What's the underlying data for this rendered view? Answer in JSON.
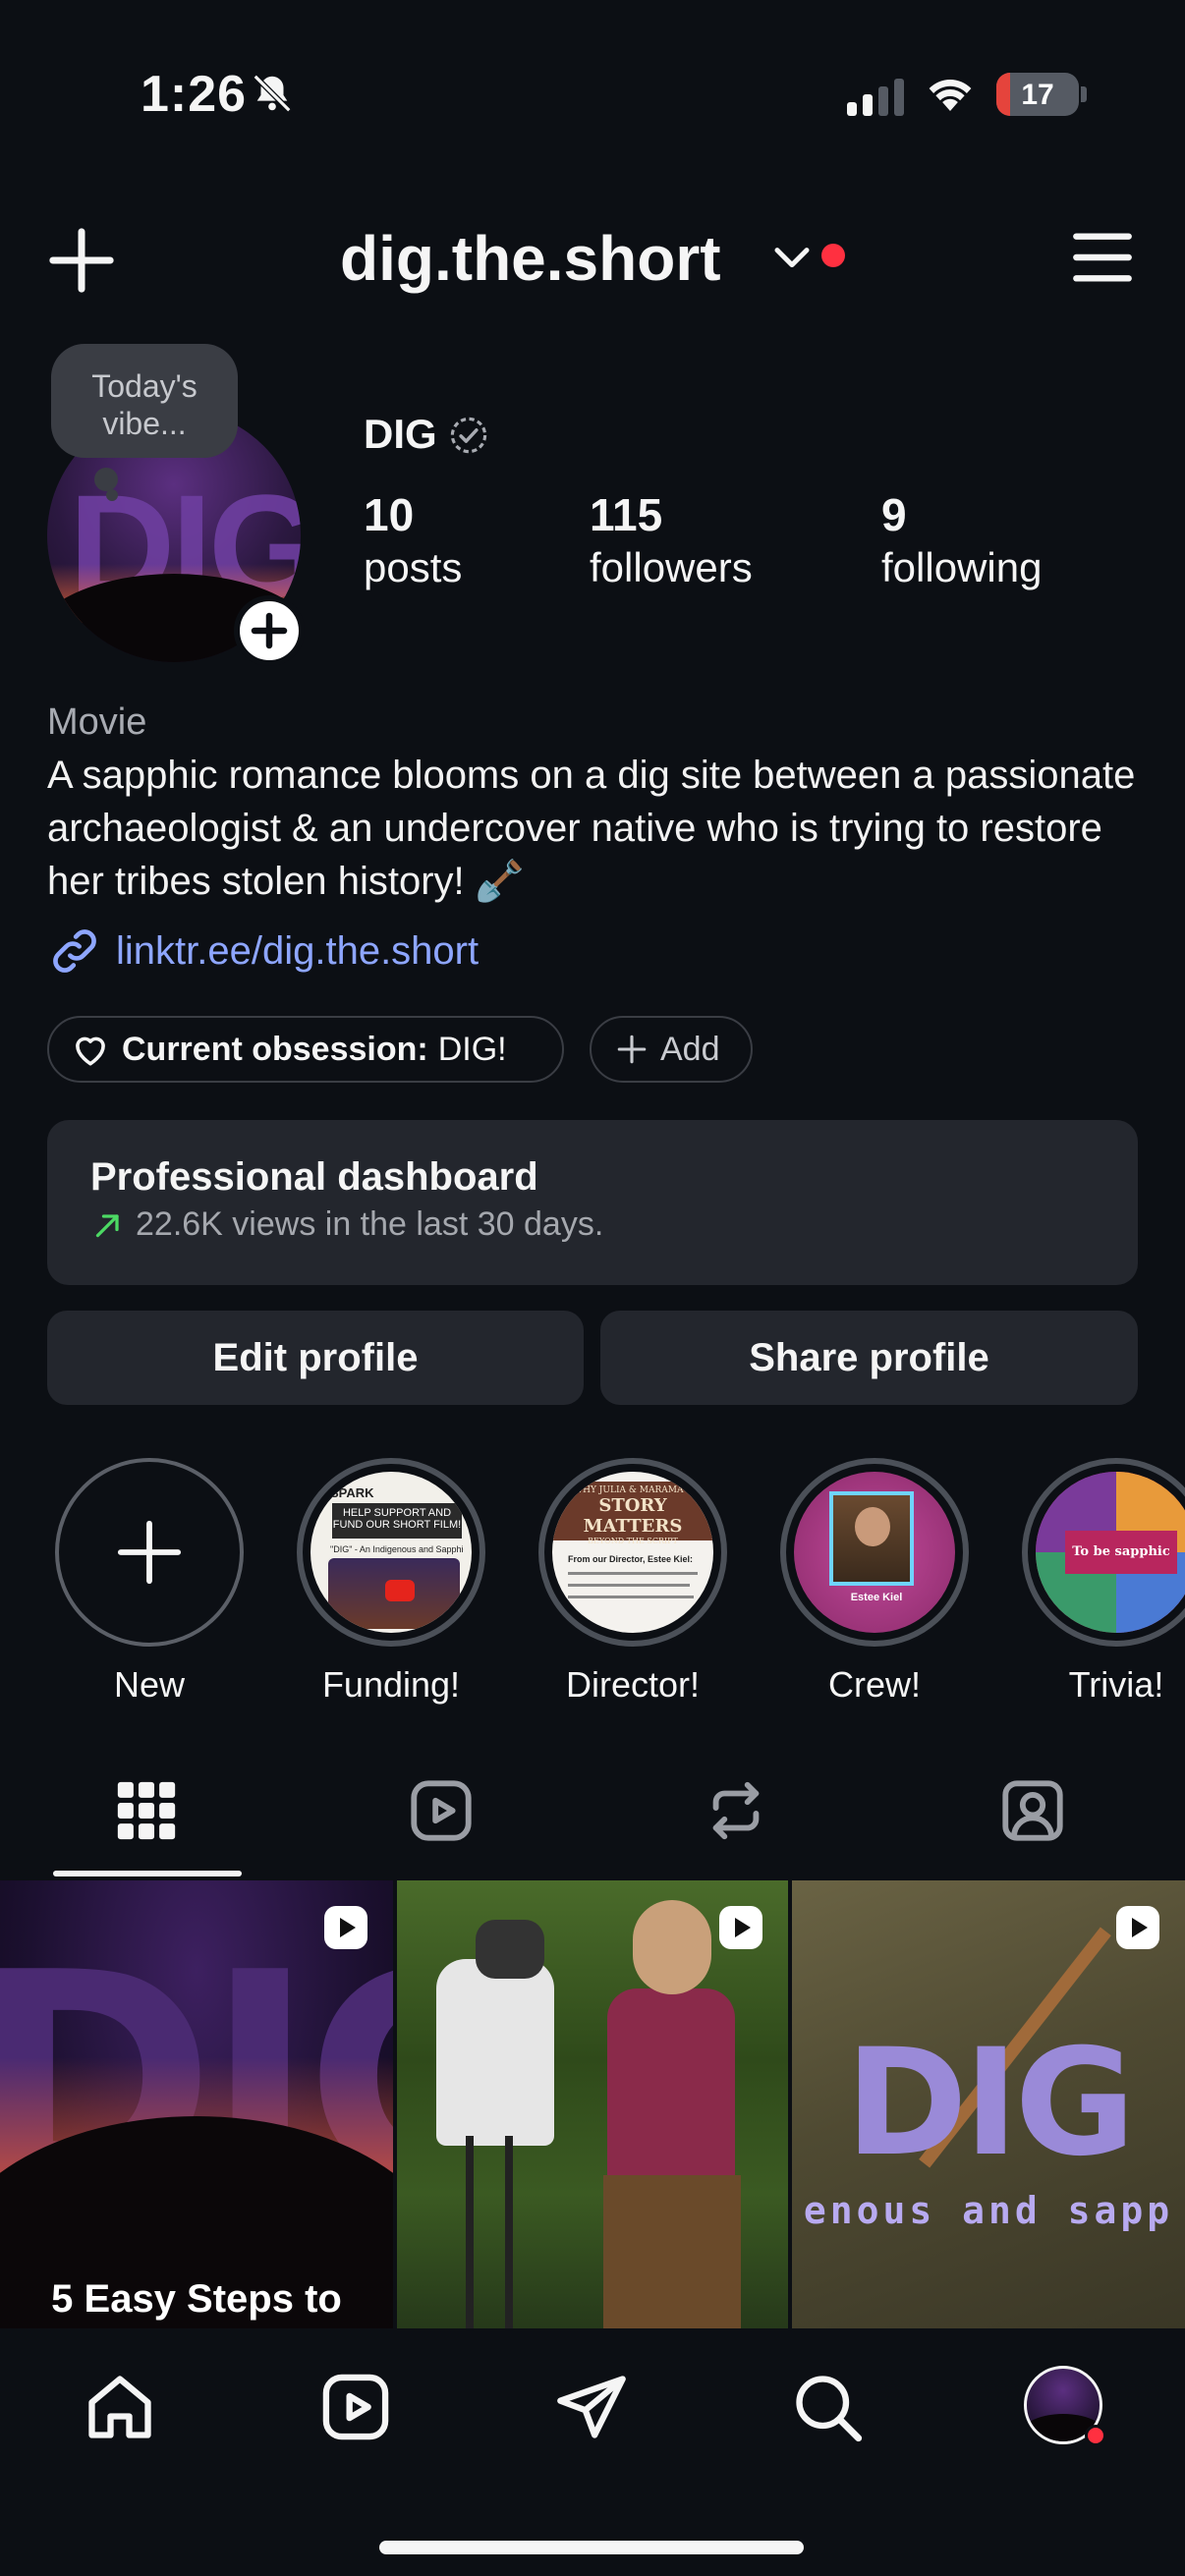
{
  "status_bar": {
    "time": "1:26",
    "battery": "17",
    "battery_level": 0.17
  },
  "header": {
    "username": "dig.the.short"
  },
  "profile": {
    "note_bubble": "Today's vibe...",
    "display_name": "DIG",
    "avatar_text": "DIG",
    "stats": [
      {
        "value": "10",
        "label": "posts"
      },
      {
        "value": "115",
        "label": "followers"
      },
      {
        "value": "9",
        "label": "following"
      }
    ],
    "category": "Movie",
    "bio": "A sapphic romance blooms on a dig site between a passionate archaeologist & an undercover native who is trying to restore her tribes stolen history! 🪏",
    "link": "linktr.ee/dig.the.short"
  },
  "pills": {
    "obsession_label": "Current obsession:",
    "obsession_value": "DIG!",
    "add_label": "Add"
  },
  "dashboard": {
    "title": "Professional dashboard",
    "subtitle": "22.6K views in the last 30 days."
  },
  "buttons": {
    "edit": "Edit profile",
    "share": "Share profile"
  },
  "highlights": [
    {
      "label": "New"
    },
    {
      "label": "Funding!"
    },
    {
      "label": "Director!"
    },
    {
      "label": "Crew!"
    },
    {
      "label": "Trivia!"
    }
  ],
  "highlight_art": {
    "funding_banner": "HELP SUPPORT AND FUND OUR SHORT FILM!",
    "funding_spark": "SPARK",
    "funding_line": "\"DIG\" - An Indigenous and Sapphic",
    "director_title": "STORY MATTERS",
    "director_top": "WHY JULIA & MARAMA'S",
    "director_sub": "BEYOND THE SCRIPT",
    "director_line": "From our Director, Estee Kiel:",
    "crew_name": "Estee Kiel",
    "trivia_title": "To be sapphic"
  },
  "grid": [
    {
      "caption": "5 Easy Steps to"
    },
    {
      "caption": ""
    },
    {
      "title": "DIG",
      "caption": "enous and sapp"
    }
  ],
  "colors": {
    "background": "#0c0f14",
    "card": "#23262d",
    "link": "#8ea6ff",
    "notification": "#ff3040",
    "battery": "#e5443c"
  }
}
